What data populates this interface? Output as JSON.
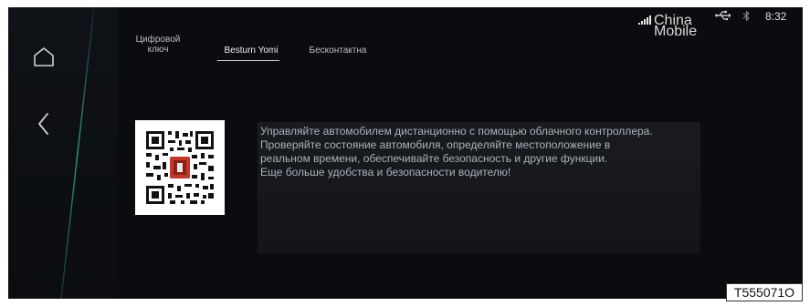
{
  "status_bar": {
    "carrier_line1": "China",
    "carrier_line2": "Mobile",
    "time": "8:32",
    "icons": [
      "signal-icon",
      "usb-icon",
      "bluetooth-icon"
    ]
  },
  "nav": {
    "icons": [
      "home-icon",
      "back-icon"
    ]
  },
  "tabs": [
    {
      "label_line1": "Цифровой",
      "label_line2": "ключ",
      "active": false
    },
    {
      "label": "Besturn Yomi",
      "active": true
    },
    {
      "label": "Бесконтактна",
      "active": false
    }
  ],
  "qr": {
    "icon": "qr-code-icon"
  },
  "description": {
    "line1": "Управляйте автомобилем дистанционно с помощью облачного контроллера.",
    "line2": "Проверяйте состояние автомобиля, определяйте местоположение в",
    "line3": "реальном времени, обеспечивайте безопасность и другие функции.",
    "line4": "Еще больше удобства и безопасности водителю!"
  },
  "reference_code": "T555071O",
  "colors": {
    "screen_bg": "#0a0c0f",
    "accent_divider": "#3aa7a0",
    "text_primary": "#a9b3c0",
    "qr_badge": "#c0392b"
  }
}
